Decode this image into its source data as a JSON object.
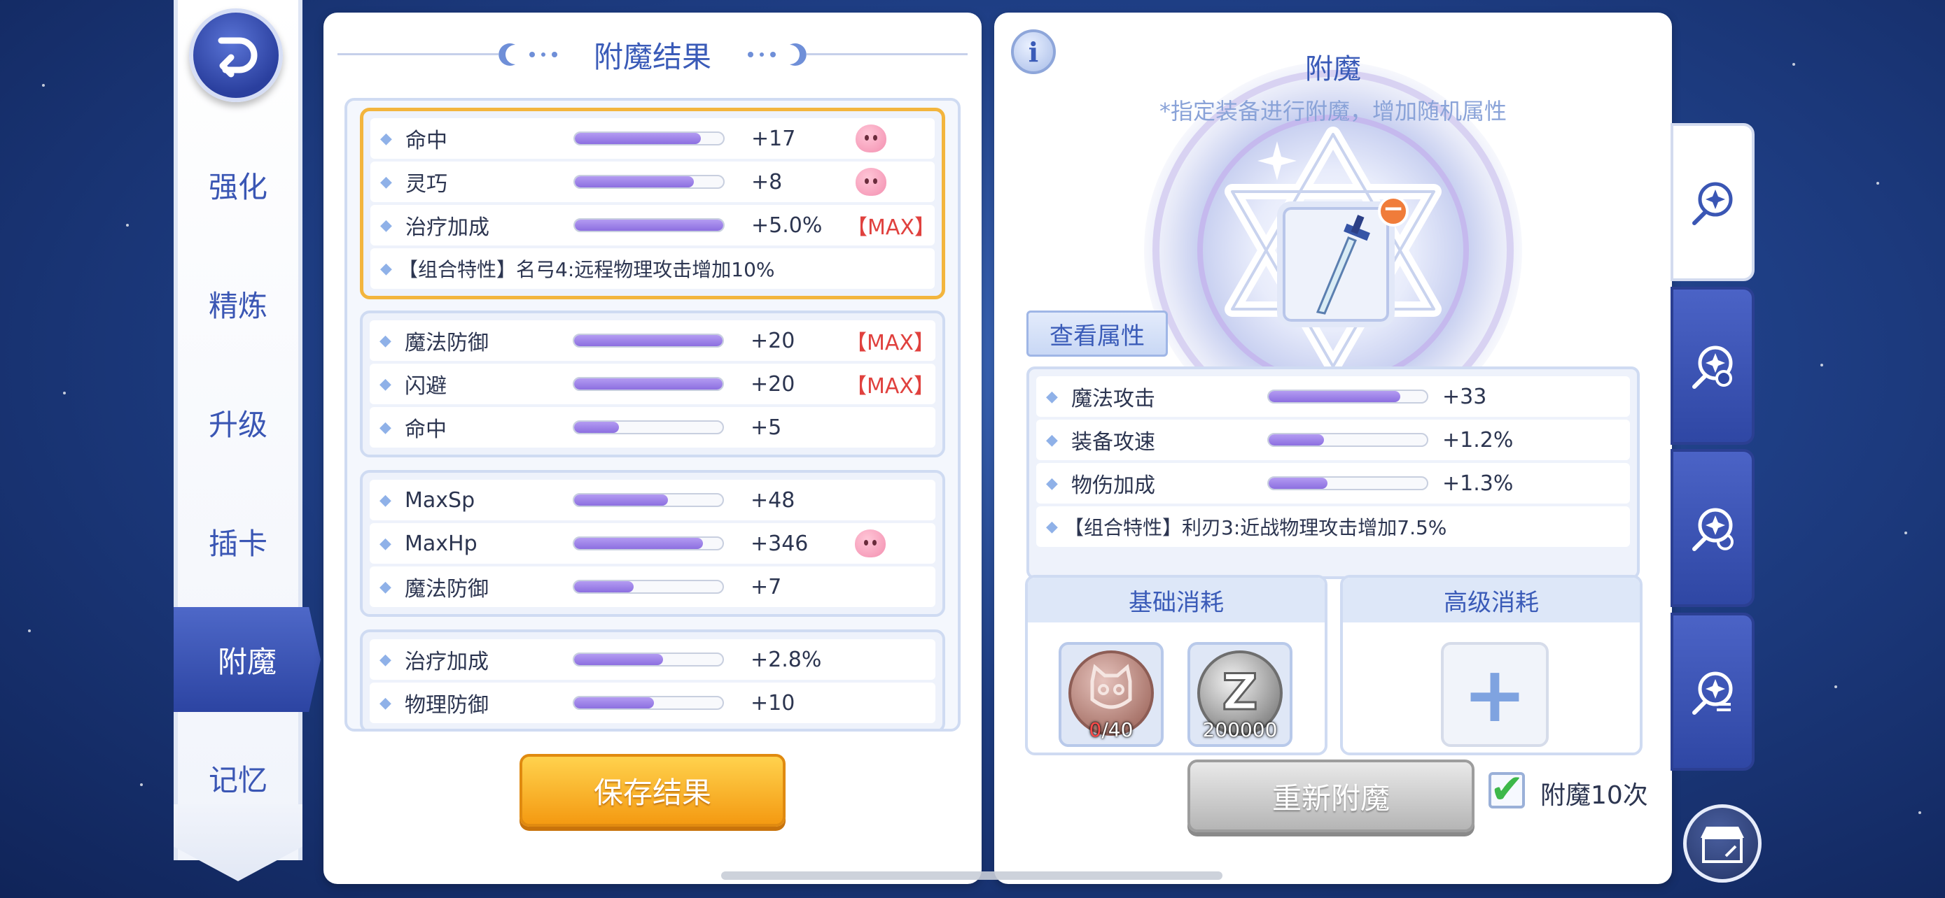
{
  "nav": {
    "items": [
      {
        "label": "强化"
      },
      {
        "label": "精炼"
      },
      {
        "label": "升级"
      },
      {
        "label": "插卡"
      },
      {
        "label": "附魔"
      },
      {
        "label": "记忆"
      }
    ],
    "active_index": 4
  },
  "result_panel": {
    "title": "附魔结果",
    "groups": [
      {
        "highlighted": true,
        "rows": [
          {
            "name": "命中",
            "progress": 0.85,
            "value": "+17",
            "max": "",
            "poring": true
          },
          {
            "name": "灵巧",
            "progress": 0.8,
            "value": "+8",
            "max": "",
            "poring": true
          },
          {
            "name": "治疗加成",
            "progress": 1.0,
            "value": "+5.0%",
            "max": "【MAX】",
            "poring": false
          }
        ],
        "combo": "【组合特性】名弓4:远程物理攻击增加10%"
      },
      {
        "highlighted": false,
        "rows": [
          {
            "name": "魔法防御",
            "progress": 1.0,
            "value": "+20",
            "max": "【MAX】",
            "poring": false
          },
          {
            "name": "闪避",
            "progress": 1.0,
            "value": "+20",
            "max": "【MAX】",
            "poring": false
          },
          {
            "name": "命中",
            "progress": 0.3,
            "value": "+5",
            "max": "",
            "poring": false
          }
        ]
      },
      {
        "highlighted": false,
        "rows": [
          {
            "name": "MaxSp",
            "progress": 0.63,
            "value": "+48",
            "max": "",
            "poring": false
          },
          {
            "name": "MaxHp",
            "progress": 0.87,
            "value": "+346",
            "max": "",
            "poring": true
          },
          {
            "name": "魔法防御",
            "progress": 0.4,
            "value": "+7",
            "max": "",
            "poring": false
          }
        ]
      },
      {
        "highlighted": false,
        "rows": [
          {
            "name": "治疗加成",
            "progress": 0.6,
            "value": "+2.8%",
            "max": "",
            "poring": false
          },
          {
            "name": "物理防御",
            "progress": 0.54,
            "value": "+10",
            "max": "",
            "poring": false
          }
        ]
      }
    ],
    "save_button": "保存结果"
  },
  "enchant_panel": {
    "title": "附魔",
    "subtitle": "*指定装备进行附魔，增加随机属性",
    "view_attributes": "查看属性",
    "attributes": [
      {
        "name": "魔法攻击",
        "progress": 0.83,
        "value": "+33"
      },
      {
        "name": "装备攻速",
        "progress": 0.35,
        "value": "+1.2%"
      },
      {
        "name": "物伤加成",
        "progress": 0.37,
        "value": "+1.3%"
      }
    ],
    "combo": "【组合特性】利刃3:近战物理攻击增加7.5%",
    "basic_cost": {
      "title": "基础消耗",
      "items": [
        {
          "icon": "cat-medal-icon",
          "count_have": "0",
          "count_need": "/40"
        },
        {
          "icon": "zeny-coin-icon",
          "count": "200000"
        }
      ]
    },
    "advanced_cost": {
      "title": "高级消耗",
      "add_icon": "plus-icon"
    },
    "reenchant_button": "重新附魔",
    "repeat_option": {
      "label": "附魔10次",
      "checked": true
    }
  },
  "side_tabs": [
    "enchant-star-icon",
    "enchant-refresh-icon",
    "enchant-swap-icon",
    "enchant-list-icon"
  ],
  "colors": {
    "accent": "#3a5bb8",
    "max": "#e0413e",
    "save": "#f49a12",
    "tab": "#2f47a4"
  }
}
